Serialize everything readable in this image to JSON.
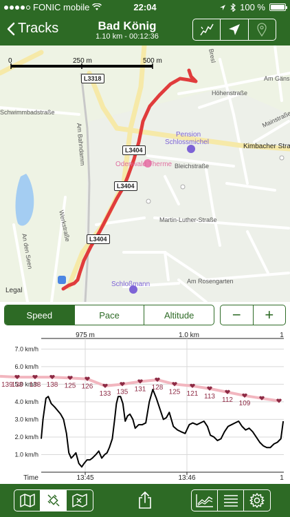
{
  "status": {
    "carrier": "FONIC mobile",
    "time": "22:04",
    "battery": "100 %"
  },
  "nav": {
    "back_label": "Tracks",
    "title": "Bad König",
    "subtitle": "1.10 km - 00:12:36"
  },
  "map": {
    "scale": [
      "0",
      "250 m",
      "500 m"
    ],
    "legal": "Legal",
    "road_shields": [
      "L3318",
      "L3404",
      "L3404",
      "L3404"
    ],
    "streets": {
      "schwimmbad": "Schwimmbadstraße",
      "bahndamm": "Am Bahndamm",
      "werk": "Werkstraße",
      "seen": "An den Seen",
      "bleich": "Bleichstraße",
      "luther": "Martin-Luther-Straße",
      "rosengarten": "Am Rosengarten",
      "hoehen": "Höhenstraße",
      "kimbacher": "Kimbacher Stra",
      "main": "Mainstraße",
      "gaens": "Am Gänsb",
      "bresl": "Bresl"
    },
    "pois": {
      "pension_line1": "Pension",
      "pension_line2": "Schlossmichel",
      "therme": "Odenwald Therme",
      "schloss": "Schloßmann"
    },
    "colors": {
      "track": "#e03c3c",
      "background": "#eef3e4"
    }
  },
  "tabs": {
    "items": [
      "Speed",
      "Pace",
      "Altitude"
    ],
    "active": "Speed"
  },
  "zoom": {
    "minus": "−",
    "plus": "+"
  },
  "chart_data": {
    "type": "line",
    "top_axis_labels": [
      "975 m",
      "1.0 km",
      "1"
    ],
    "bottom_axis_labels": [
      "Time",
      "13:45",
      "13:46",
      "1"
    ],
    "ylabel_unit": "km/h",
    "y_ticks": [
      "1.0 km/h",
      "2.0 km/h",
      "3.0 km/h",
      "4.0 km/h",
      "5.0 km/h",
      "6.0 km/h",
      "7.0 km/h"
    ],
    "ylim": [
      0,
      7.6
    ],
    "grid": true,
    "speed": {
      "color": "#000000",
      "x": [
        0,
        3,
        8,
        12,
        17,
        23,
        28,
        33,
        38,
        43,
        47,
        51,
        54,
        59,
        64,
        69,
        73,
        78,
        83,
        87,
        93,
        98,
        103,
        108,
        112,
        116,
        121,
        125,
        128,
        131,
        135,
        139,
        143,
        147,
        151,
        156,
        160,
        166,
        172,
        178,
        184,
        190,
        196,
        203,
        208,
        213,
        218,
        225,
        232,
        238,
        245,
        252,
        258,
        265,
        271,
        277,
        283,
        288,
        294,
        300,
        306,
        312,
        318,
        324,
        330,
        336,
        342,
        348,
        354,
        360,
        366,
        372,
        378,
        384,
        390,
        396,
        402,
        408,
        412
      ],
      "y": [
        1.9,
        3.0,
        4.2,
        4.3,
        3.9,
        3.7,
        3.5,
        3.3,
        3.0,
        2.2,
        1.1,
        0.8,
        0.9,
        1.1,
        0.5,
        0.3,
        0.5,
        0.7,
        0.7,
        0.8,
        1.0,
        1.2,
        0.8,
        1.0,
        1.1,
        1.4,
        1.9,
        3.0,
        3.9,
        4.3,
        4.3,
        3.9,
        2.9,
        3.2,
        3.3,
        3.0,
        2.5,
        2.7,
        2.7,
        2.8,
        4.0,
        4.7,
        4.2,
        3.5,
        3.0,
        3.1,
        3.4,
        2.6,
        2.4,
        2.3,
        2.2,
        2.7,
        2.8,
        2.7,
        2.8,
        2.9,
        2.6,
        2.1,
        2.0,
        1.8,
        1.9,
        2.3,
        2.6,
        2.7,
        2.8,
        2.9,
        2.6,
        2.4,
        2.5,
        2.3,
        2.0,
        1.7,
        1.5,
        1.4,
        1.4,
        1.6,
        1.7,
        1.9,
        2.9
      ]
    },
    "altitude": {
      "color": "#c45a6a",
      "labels": [
        "139",
        "138",
        "138",
        "138",
        "125",
        "126",
        "133",
        "135",
        "131",
        "128",
        "125",
        "121",
        "113",
        "112",
        "109"
      ],
      "x": [
        0,
        25,
        51,
        76,
        102,
        127,
        153,
        178,
        204,
        229,
        254,
        280,
        305,
        331,
        356,
        381,
        406
      ],
      "y": [
        5.45,
        5.4,
        5.4,
        5.4,
        5.35,
        5.3,
        4.9,
        5.0,
        5.15,
        5.25,
        5.0,
        4.9,
        4.75,
        4.55,
        4.35,
        4.2,
        4.05
      ],
      "marker_x": [
        25,
        51,
        76,
        102,
        127,
        153,
        178,
        204,
        229,
        254,
        280,
        305,
        331,
        356,
        381,
        406
      ],
      "marker_y": [
        5.4,
        5.4,
        5.4,
        5.35,
        5.3,
        4.9,
        5.0,
        5.15,
        5.25,
        5.0,
        4.9,
        4.75,
        4.55,
        4.35,
        4.2,
        4.05
      ]
    }
  }
}
